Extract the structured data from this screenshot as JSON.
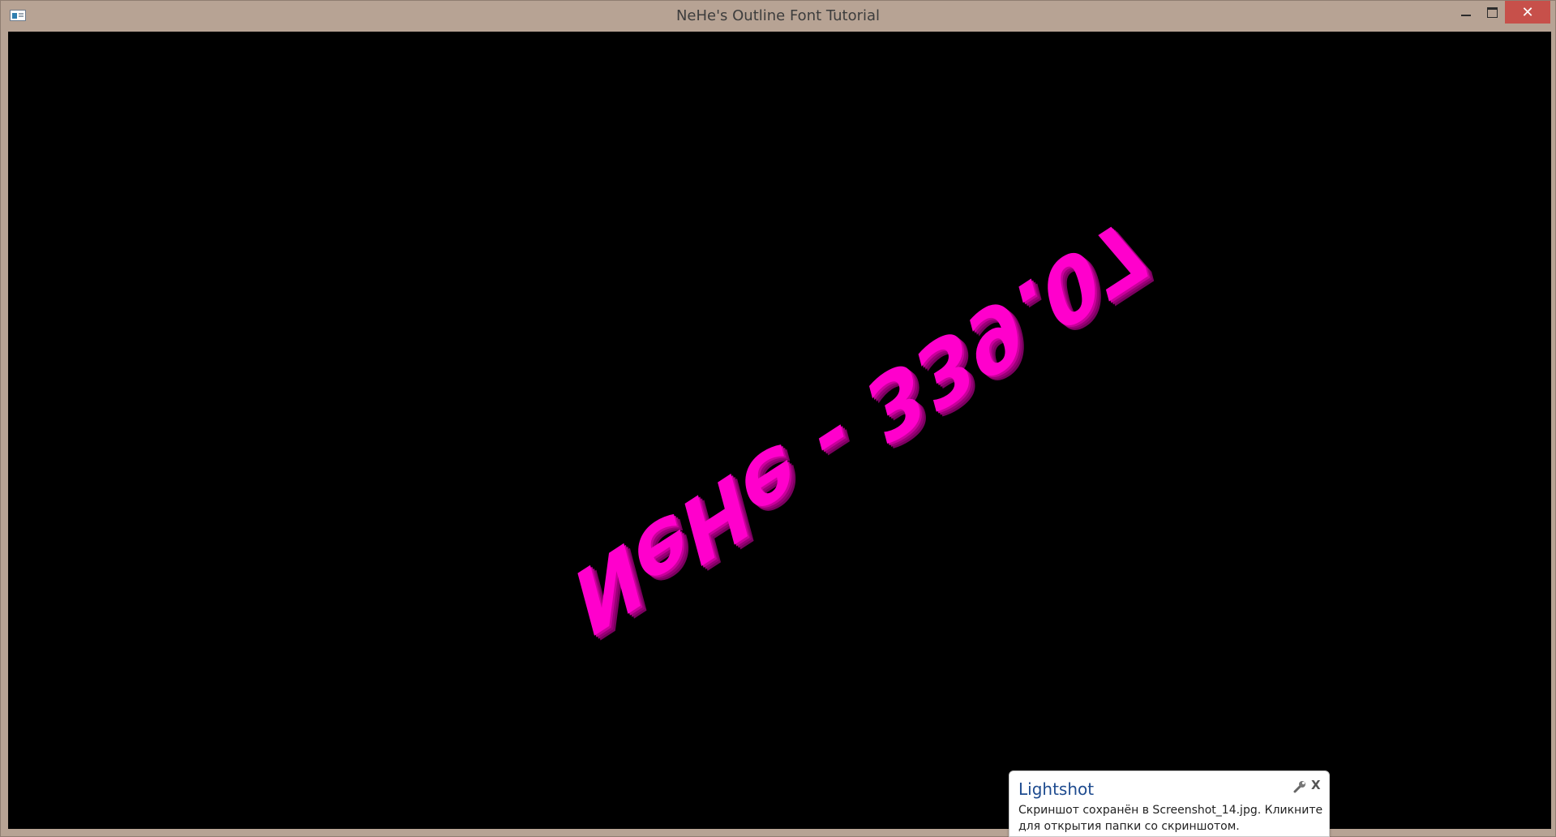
{
  "window": {
    "title": "NeHe's Outline Font Tutorial",
    "close_glyph": "✕"
  },
  "scene": {
    "text": "NeHe - 339.07",
    "text_color": "#ff00cc",
    "shade_color": "#b8008f",
    "background": "#000000"
  },
  "toast": {
    "title": "Lightshot",
    "message": "Скриншот сохранён в Screenshot_14.jpg. Кликните для открытия папки со скриншотом.",
    "settings_icon": "wrench-icon",
    "close_glyph": "X"
  },
  "colors": {
    "frame": "#b7a394",
    "close_button": "#c7504a",
    "toast_title": "#1e4b8f"
  }
}
